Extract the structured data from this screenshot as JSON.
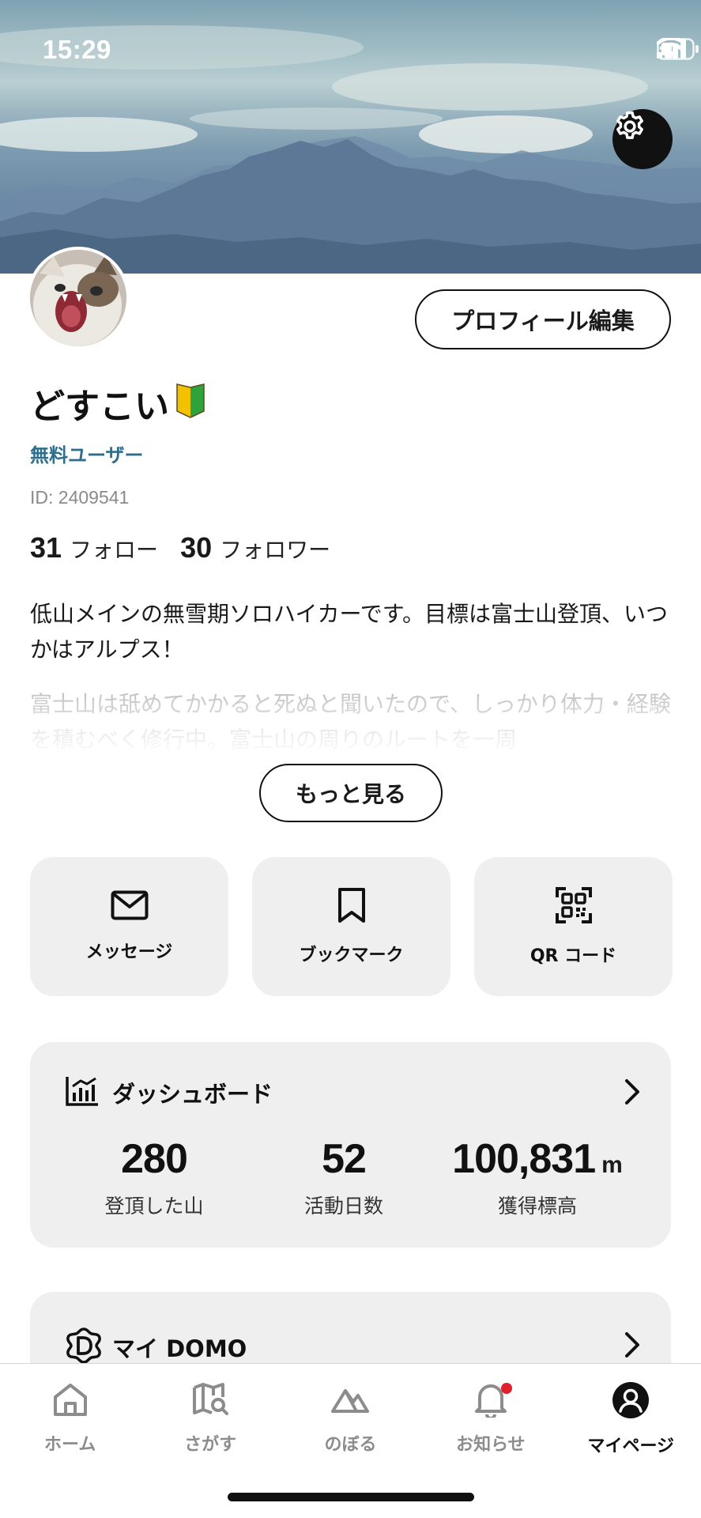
{
  "status_bar": {
    "time": "15:29"
  },
  "profile": {
    "edit_button": "プロフィール編集",
    "name": "どすこい",
    "plan": "無料ユーザー",
    "id_text": "ID: 2409541",
    "following_count": "31",
    "following_label": "フォロー",
    "followers_count": "30",
    "followers_label": "フォロワー",
    "bio": "低山メインの無雪期ソロハイカーです。目標は富士山登頂、いつかはアルプス！",
    "bio_more": "富士山は舐めてかかると死ぬと聞いたので、しっかり体力・経験を積むべく修行中。富士山の周りのルートを一周",
    "more_button": "もっと見る"
  },
  "actions": [
    {
      "label": "メッセージ",
      "icon": "mail-icon"
    },
    {
      "label": "ブックマーク",
      "icon": "bookmark-icon"
    },
    {
      "label": "QR コード",
      "icon": "qr-code-icon"
    }
  ],
  "dashboard": {
    "title": "ダッシュボード",
    "stats": [
      {
        "value": "280",
        "unit": "",
        "label": "登頂した山"
      },
      {
        "value": "52",
        "unit": "",
        "label": "活動日数"
      },
      {
        "value": "100,831",
        "unit": "m",
        "label": "獲得標高"
      }
    ]
  },
  "domo": {
    "title": "マイ DOMO"
  },
  "tabbar": {
    "items": [
      {
        "label": "ホーム",
        "icon": "home-icon"
      },
      {
        "label": "さがす",
        "icon": "map-search-icon"
      },
      {
        "label": "のぼる",
        "icon": "mountain-icon"
      },
      {
        "label": "お知らせ",
        "icon": "bell-icon"
      },
      {
        "label": "マイページ",
        "icon": "user-icon"
      }
    ],
    "active_index": 4
  },
  "colors": {
    "plan_badge": "#2f6d8d",
    "card_background": "#efefef",
    "notification_dot": "#e0202b",
    "active_tab": "#111111",
    "inactive_tab": "#8c8c8c"
  }
}
